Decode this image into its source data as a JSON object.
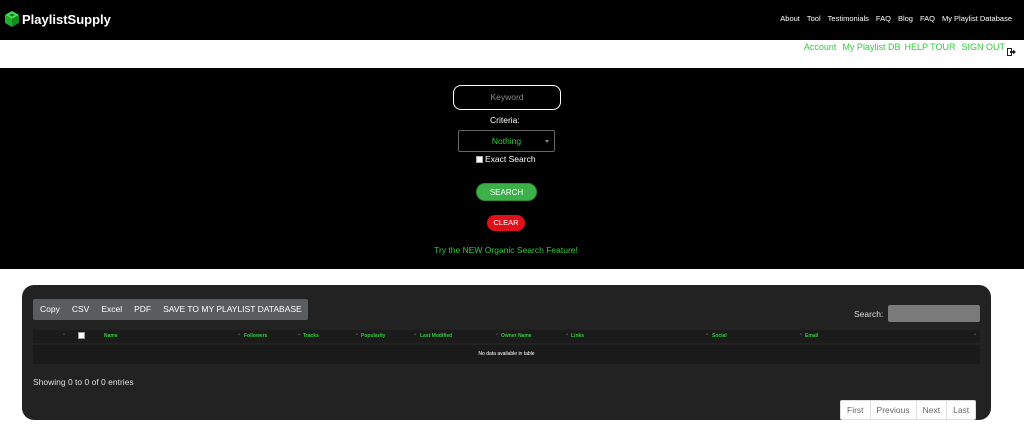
{
  "brand": {
    "name": "PlaylistSupply",
    "green": "#2fcc3b",
    "dark_green": "#1a8a26"
  },
  "topnav": [
    "About",
    "Tool",
    "Testimonials",
    "FAQ",
    "Blog",
    "FAQ",
    "My Playlist Database"
  ],
  "subnav": [
    "Account",
    "My Playlist DB",
    "HELP TOUR",
    "SIGN OUT"
  ],
  "search": {
    "keyword_placeholder": "Keyword",
    "criteria_label": "Criteria:",
    "criteria_value": "Nothing",
    "exact_label": "Exact Search",
    "search_button": "SEARCH",
    "clear_button": "CLEAR",
    "organic_link": "Try the NEW Organic Search Feature!"
  },
  "table": {
    "buttons": [
      "Copy",
      "CSV",
      "Excel",
      "PDF",
      "SAVE TO MY PLAYLIST DATABASE"
    ],
    "search_label": "Search:",
    "columns": [
      "Name",
      "Followers",
      "Tracks",
      "Popularity",
      "Last Modified",
      "Owner Name",
      "Links",
      "Social",
      "Email"
    ],
    "empty_message": "No data available in table",
    "info": "Showing 0 to 0 of 0 entries",
    "pager": [
      "First",
      "Previous",
      "Next",
      "Last"
    ]
  }
}
